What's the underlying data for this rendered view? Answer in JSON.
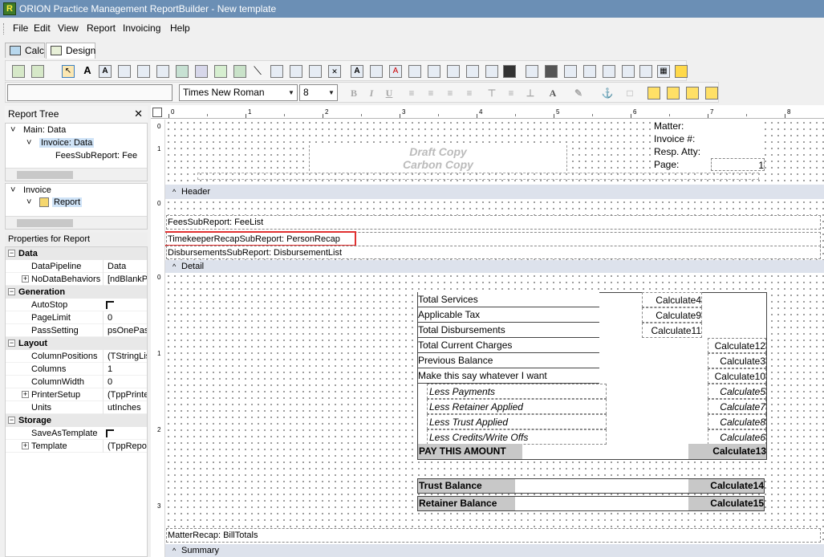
{
  "window": {
    "title": "ORION Practice Management ReportBuilder - New template"
  },
  "menu": [
    "File",
    "Edit",
    "View",
    "Report",
    "Invoicing",
    "Help"
  ],
  "tabs": [
    {
      "label": "Calc"
    },
    {
      "label": "Design"
    }
  ],
  "font_toolbar": {
    "font_name": "Times New Roman",
    "font_size": "8"
  },
  "report_tree": {
    "title": "Report Tree",
    "tree1": [
      "Main: Data",
      "Invoice: Data",
      "FeesSubReport: Fee"
    ],
    "tree2": [
      "Invoice",
      "Report"
    ]
  },
  "properties": {
    "title": "Properties for Report",
    "cat_data": "Data",
    "cat_generation": "Generation",
    "cat_layout": "Layout",
    "cat_storage": "Storage",
    "rows": [
      {
        "name": "DataPipeline",
        "value": "Data"
      },
      {
        "name": "NoDataBehaviors",
        "value": "[ndBlankPag"
      },
      {
        "name": "AutoStop",
        "value": ""
      },
      {
        "name": "PageLimit",
        "value": "0"
      },
      {
        "name": "PassSetting",
        "value": "psOnePass"
      },
      {
        "name": "ColumnPositions",
        "value": "(TStringList)"
      },
      {
        "name": "Columns",
        "value": "1"
      },
      {
        "name": "ColumnWidth",
        "value": "0"
      },
      {
        "name": "PrinterSetup",
        "value": "(TppPrinterS"
      },
      {
        "name": "Units",
        "value": "utInches"
      },
      {
        "name": "SaveAsTemplate",
        "value": ""
      },
      {
        "name": "Template",
        "value": "(TppReportT"
      }
    ]
  },
  "ruler": {
    "top_numbers": [
      "0",
      "1",
      "2",
      "3",
      "4",
      "5",
      "6",
      "7",
      "8"
    ],
    "side_numbers": [
      "0",
      "1",
      "0",
      "0",
      "1",
      "2",
      "3"
    ]
  },
  "header_band": {
    "label": "Header",
    "draft": "Draft Copy",
    "carbon": "Carbon Copy",
    "matter_label": "Matter:",
    "invoice_label": "Invoice #:",
    "resp_label": "Resp. Atty:",
    "page_label": "Page:",
    "page_value": "1"
  },
  "detail_band": {
    "label": "Detail",
    "fees": "FeesSubReport: FeeList",
    "timekeeper": "TimekeeperRecapSubReport: PersonRecap",
    "disbursements": "DisbursementsSubReport: DisbursementList"
  },
  "summary": {
    "label": "Summary",
    "matter_recap": "MatterRecap: BillTotals",
    "total_services": "Total Services",
    "calc4": "Calculate4",
    "applicable_tax": "Applicable Tax",
    "calc9": "Calculate9",
    "total_disbursements": "Total Disbursements",
    "calc11": "Calculate11",
    "total_current": "Total Current Charges",
    "calc12": "Calculate12",
    "previous_balance": "Previous Balance",
    "calc3": "Calculate3",
    "say_whatever": "Make this say whatever I want",
    "calc10": "Calculate10",
    "less_payments": "Less Payments",
    "calc5": "Calculate5",
    "less_retainer": "Less Retainer Applied",
    "calc7": "Calculate7",
    "less_trust": "Less Trust Applied",
    "calc8": "Calculate8",
    "less_credits": "Less Credits/Write Offs",
    "calc6": "Calculate6",
    "pay_amount": "PAY THIS AMOUNT",
    "calc13": "Calculate13",
    "trust_balance": "Trust Balance",
    "calc14": "Calculate14",
    "retainer_balance": "Retainer Balance",
    "calc15": "Calculate15"
  },
  "colors": {
    "highlight": "#e03030",
    "titlebar": "#6b8fb5",
    "band_bar": "#dde2ec"
  }
}
